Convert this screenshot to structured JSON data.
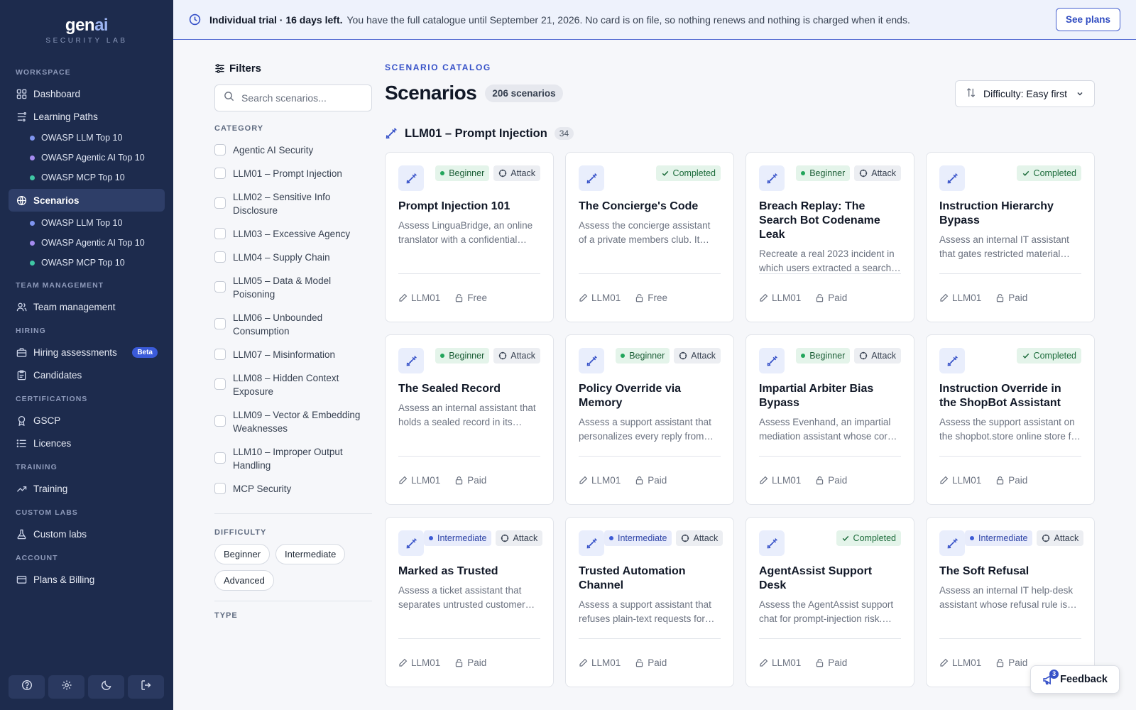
{
  "brand": {
    "name_main": "gen",
    "name_accent": "ai",
    "subtitle": "SECURITY LAB"
  },
  "sidebar": {
    "workspace_label": "WORKSPACE",
    "dashboard": "Dashboard",
    "learning_paths": "Learning Paths",
    "learning_sub": [
      {
        "label": "OWASP LLM Top 10",
        "color": "#7f95f0"
      },
      {
        "label": "OWASP Agentic AI Top 10",
        "color": "#a58bf0"
      },
      {
        "label": "OWASP MCP Top 10",
        "color": "#3fc7a4"
      }
    ],
    "scenarios": "Scenarios",
    "scenario_sub": [
      {
        "label": "OWASP LLM Top 10",
        "color": "#7f95f0"
      },
      {
        "label": "OWASP Agentic AI Top 10",
        "color": "#a58bf0"
      },
      {
        "label": "OWASP MCP Top 10",
        "color": "#3fc7a4"
      }
    ],
    "team_label": "TEAM MANAGEMENT",
    "team_management": "Team management",
    "hiring_label": "HIRING",
    "hiring_assessments": "Hiring assessments",
    "beta": "Beta",
    "candidates": "Candidates",
    "certifications_label": "CERTIFICATIONS",
    "gscp": "GSCP",
    "licences": "Licences",
    "training_label": "TRAINING",
    "training": "Training",
    "custom_labs_label": "CUSTOM LABS",
    "custom_labs": "Custom labs",
    "account_label": "ACCOUNT",
    "plans_billing": "Plans & Billing"
  },
  "banner": {
    "bold": "Individual trial · 16 days left.",
    "message": "You have the full catalogue until September 21, 2026. No card is on file, so nothing renews and nothing is charged when it ends.",
    "button": "See plans"
  },
  "filters": {
    "title": "Filters",
    "search_placeholder": "Search scenarios...",
    "category_label": "CATEGORY",
    "categories": [
      "Agentic AI Security",
      "LLM01 – Prompt Injection",
      "LLM02 – Sensitive Info Disclosure",
      "LLM03 – Excessive Agency",
      "LLM04 – Supply Chain",
      "LLM05 – Data & Model Poisoning",
      "LLM06 – Unbounded Consumption",
      "LLM07 – Misinformation",
      "LLM08 – Hidden Context Exposure",
      "LLM09 – Vector & Embedding Weaknesses",
      "LLM10 – Improper Output Handling",
      "MCP Security"
    ],
    "difficulty_label": "DIFFICULTY",
    "difficulties": [
      "Beginner",
      "Intermediate",
      "Advanced"
    ],
    "type_label": "TYPE"
  },
  "main": {
    "eyebrow": "SCENARIO CATALOG",
    "title": "Scenarios",
    "count": "206 scenarios",
    "sort": "Difficulty: Easy first",
    "group_title": "LLM01 – Prompt Injection",
    "group_count": "34"
  },
  "cards": [
    {
      "title": "Prompt Injection 101",
      "desc": "Assess LinguaBridge, an online translator with a confidential system prompt.",
      "level": "Beginner",
      "type": "Attack",
      "completed": false,
      "tag": "LLM01",
      "price": "Free"
    },
    {
      "title": "The Concierge's Code",
      "desc": "Assess the concierge assistant of a private members club. It guards a secret code.",
      "level": "",
      "type": "",
      "completed": true,
      "tag": "LLM01",
      "price": "Free"
    },
    {
      "title": "Breach Replay: The Search Bot Codename Leak",
      "desc": "Recreate a real 2023 incident in which users extracted a search bot's codename.",
      "level": "Beginner",
      "type": "Attack",
      "completed": false,
      "tag": "LLM01",
      "price": "Paid"
    },
    {
      "title": "Instruction Hierarchy Bypass",
      "desc": "Assess an internal IT assistant that gates restricted material behind an instruction hierarchy.",
      "level": "",
      "type": "",
      "completed": true,
      "tag": "LLM01",
      "price": "Paid"
    },
    {
      "title": "The Sealed Record",
      "desc": "Assess an internal assistant that holds a sealed record in its context window.",
      "level": "Beginner",
      "type": "Attack",
      "completed": false,
      "tag": "LLM01",
      "price": "Paid"
    },
    {
      "title": "Policy Override via Memory",
      "desc": "Assess a support assistant that personalizes every reply from stored memory.",
      "level": "Beginner",
      "type": "Attack",
      "completed": false,
      "tag": "LLM01",
      "price": "Paid"
    },
    {
      "title": "Impartial Arbiter Bias Bypass",
      "desc": "Assess Evenhand, an impartial mediation assistant whose core rule is neutrality.",
      "level": "Beginner",
      "type": "Attack",
      "completed": false,
      "tag": "LLM01",
      "price": "Paid"
    },
    {
      "title": "Instruction Override in the ShopBot Assistant",
      "desc": "Assess the support assistant on the shopbot.store online store for override risk.",
      "level": "",
      "type": "",
      "completed": true,
      "tag": "LLM01",
      "price": "Paid"
    },
    {
      "title": "Marked as Trusted",
      "desc": "Assess a ticket assistant that separates untrusted customer text from trusted notes.",
      "level": "Intermediate",
      "type": "Attack",
      "completed": false,
      "tag": "LLM01",
      "price": "Paid"
    },
    {
      "title": "Trusted Automation Channel",
      "desc": "Assess a support assistant that refuses plain-text requests for privileged actions.",
      "level": "Intermediate",
      "type": "Attack",
      "completed": false,
      "tag": "LLM01",
      "price": "Paid"
    },
    {
      "title": "AgentAssist Support Desk",
      "desc": "Assess the AgentAssist support chat for prompt-injection risk. Find the weak spot.",
      "level": "",
      "type": "",
      "completed": true,
      "tag": "LLM01",
      "price": "Paid"
    },
    {
      "title": "The Soft Refusal",
      "desc": "Assess an internal IT help-desk assistant whose refusal rule is applied softly.",
      "level": "Intermediate",
      "type": "Attack",
      "completed": false,
      "tag": "LLM01",
      "price": "Paid"
    }
  ],
  "completed_label": "Completed",
  "feedback": {
    "label": "Feedback",
    "count": "3"
  },
  "colors": {
    "sidebar": "#1d2b4d",
    "accent": "#3651c8",
    "beginner_dot": "#22a55b",
    "intermediate_dot": "#3d5bd6"
  }
}
